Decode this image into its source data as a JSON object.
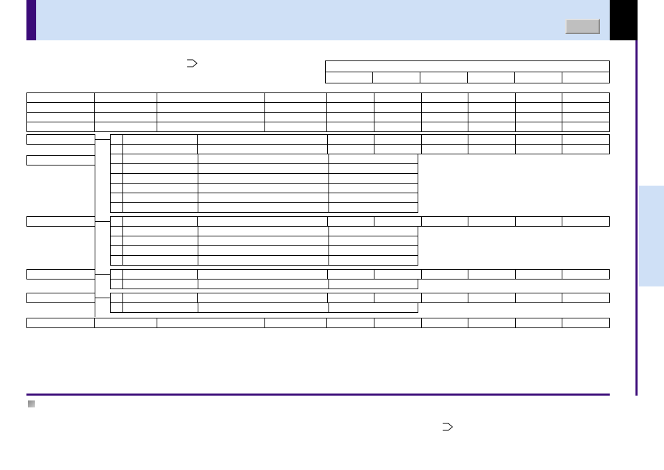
{
  "banner": {
    "title": ""
  },
  "years": [
    "",
    "",
    "",
    "",
    "",
    ""
  ],
  "year_header_top": "",
  "rows_top": [
    {
      "a": "",
      "b": "",
      "c": "",
      "d": "",
      "cells": [
        "",
        "",
        "",
        "",
        "",
        ""
      ]
    },
    {
      "a": "",
      "b": "",
      "c": "",
      "d": "",
      "cells": [
        "",
        "",
        "",
        "",
        "",
        ""
      ]
    },
    {
      "a": "",
      "b": "",
      "c": "",
      "d": "",
      "cells": [
        "",
        "",
        "",
        "",
        "",
        ""
      ]
    },
    {
      "a": "",
      "b": "",
      "c": "",
      "d": "",
      "cells": [
        "",
        "",
        "",
        "",
        "",
        ""
      ]
    }
  ],
  "section1": {
    "label": "",
    "sub": ""
  },
  "section1_rows": [
    {
      "c": "",
      "d": "",
      "cells": [
        "",
        "",
        "",
        "",
        "",
        ""
      ]
    },
    {
      "c": "",
      "d": "",
      "cells": [
        "",
        "",
        "",
        "",
        "",
        ""
      ]
    },
    {
      "c": "",
      "d": "",
      "cells": [
        "",
        "",
        "",
        "",
        "",
        ""
      ]
    },
    {
      "c": "",
      "d": "",
      "cells": [
        "",
        "",
        "",
        "",
        "",
        ""
      ]
    },
    {
      "c": "",
      "d": "",
      "cells": [
        "",
        "",
        "",
        "",
        "",
        ""
      ]
    },
    {
      "c": "",
      "d": "",
      "cells": [
        "",
        "",
        "",
        "",
        "",
        ""
      ]
    },
    {
      "c": "",
      "d": "",
      "cells": [
        "",
        "",
        "",
        "",
        "",
        ""
      ]
    },
    {
      "c": "",
      "d": "",
      "cells": [
        "",
        "",
        "",
        "",
        "",
        ""
      ]
    }
  ],
  "section2": {
    "label": ""
  },
  "section2_rows": [
    {
      "c": "",
      "d": "",
      "cells": [
        "",
        "",
        "",
        "",
        "",
        ""
      ]
    },
    {
      "c": "",
      "d": "",
      "cells": [
        "",
        "",
        "",
        "",
        "",
        ""
      ]
    },
    {
      "c": "",
      "d": "",
      "cells": [
        "",
        "",
        "",
        "",
        "",
        ""
      ]
    },
    {
      "c": "",
      "d": "",
      "cells": [
        "",
        "",
        "",
        "",
        "",
        ""
      ]
    },
    {
      "c": "",
      "d": "",
      "cells": [
        "",
        "",
        "",
        "",
        "",
        ""
      ]
    }
  ],
  "section3": {
    "label": ""
  },
  "section3_rows": [
    {
      "c": "",
      "d": "",
      "cells": [
        "",
        "",
        "",
        "",
        "",
        ""
      ]
    },
    {
      "c": "",
      "d": "",
      "cells": [
        "",
        "",
        "",
        "",
        "",
        ""
      ]
    }
  ],
  "section4": {
    "label": ""
  },
  "section4_rows": [
    {
      "c": "",
      "d": "",
      "cells": [
        "",
        "",
        "",
        "",
        "",
        ""
      ]
    },
    {
      "c": "",
      "d": "",
      "cells": [
        "",
        "",
        "",
        "",
        "",
        ""
      ]
    }
  ],
  "total_row": {
    "a": "",
    "b": "",
    "c": "",
    "d": "",
    "cells": [
      "",
      "",
      "",
      "",
      "",
      ""
    ]
  },
  "side_tab": ""
}
